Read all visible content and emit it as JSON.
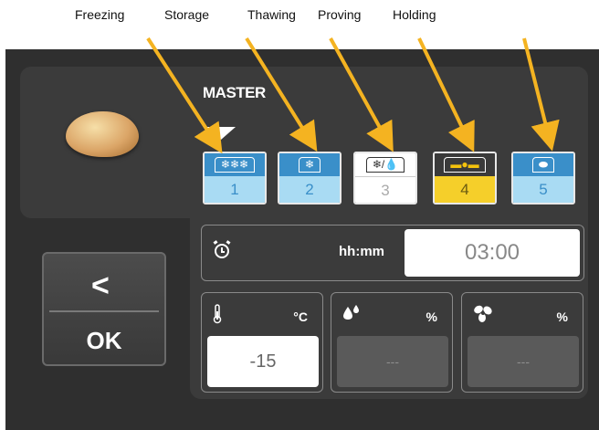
{
  "captions": [
    "Freezing",
    "Storage",
    "Thawing",
    "Proving",
    "Holding"
  ],
  "master": {
    "label": "MASTER",
    "selected_phase": 1
  },
  "phases": [
    {
      "number": "1",
      "icon": "❄❄❄",
      "icon_name": "triple-snowflake-icon",
      "state": "blue"
    },
    {
      "number": "2",
      "icon": "❄",
      "icon_name": "snowflake-icon",
      "state": "blue"
    },
    {
      "number": "3",
      "icon": "❄/💧",
      "icon_name": "snowflake-drop-icon",
      "state": "white"
    },
    {
      "number": "4",
      "icon": "▬●▬",
      "icon_name": "proving-bread-icon",
      "state": "yellow"
    },
    {
      "number": "5",
      "icon": "⬬",
      "icon_name": "bread-loaf-icon",
      "state": "blue"
    }
  ],
  "timer": {
    "label": "hh:mm",
    "value": "03:00",
    "icon": "alarm-clock-icon"
  },
  "settings": {
    "temperature": {
      "unit": "°C",
      "value": "-15",
      "icon": "thermometer-icon"
    },
    "humidity": {
      "unit": "%",
      "value": "---",
      "icon": "water-drops-icon"
    },
    "fan": {
      "unit": "%",
      "value": "---",
      "icon": "fan-icon"
    }
  },
  "back_ok": {
    "back_glyph": "<",
    "ok_label": "OK"
  },
  "colors": {
    "accent_blue": "#3a8fc9",
    "light_blue": "#a9dbf3",
    "active_yellow": "#f5cf2a",
    "arrow_orange": "#f4b321",
    "panel": "#3b3b3b"
  }
}
